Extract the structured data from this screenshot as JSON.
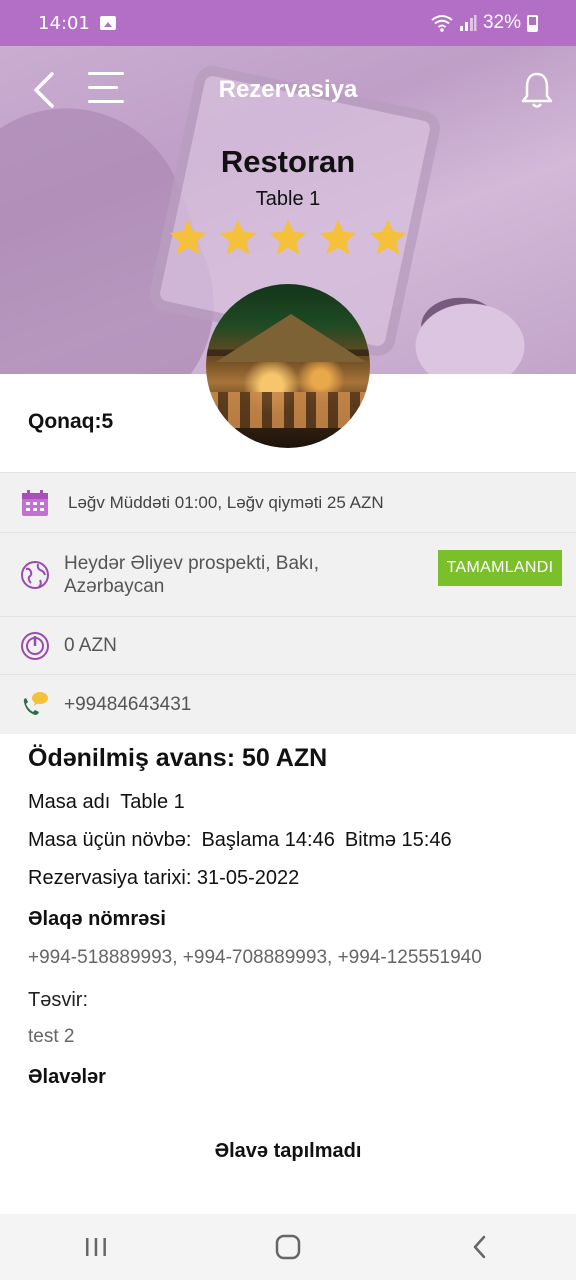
{
  "status_bar": {
    "time": "14:01",
    "battery": "32%"
  },
  "header": {
    "title": "Rezervasiya"
  },
  "restaurant": {
    "name": "Restoran",
    "table": "Table 1",
    "rating": 5,
    "rating_max": 5
  },
  "guests": {
    "label": "Qonaq:5"
  },
  "info": {
    "cancel": "Ləğv Müddəti 01:00, Ləğv qiyməti 25 AZN",
    "address": "Heydər Əliyev prospekti, Bakı, Azərbaycan",
    "status_button": "TAMAMLANDI",
    "amount": "0 AZN",
    "phone": "+99484643431"
  },
  "details": {
    "advance": "Ödənilmiş avans: 50 AZN",
    "table_label": "Masa adı",
    "table_value": "Table 1",
    "shift_label": "Masa üçün növbə:",
    "shift_start": "Başlama 14:46",
    "shift_end": "Bitmə 15:46",
    "date": "Rezervasiya tarixi: 31-05-2022",
    "contact_heading": "Əlaqə nömrəsi",
    "contact_numbers": "+994-518889993, +994-708889993, +994-125551940",
    "description_heading": "Təsvir:",
    "description_value": "test 2",
    "extras_heading": "Əlavələr",
    "extras_empty": "Əlavə tapılmadı"
  },
  "colors": {
    "status_bar": "#b36fc6",
    "accent_purple": "#9b4bb0",
    "done_green": "#7bbf2a",
    "star": "#f5c03a"
  }
}
